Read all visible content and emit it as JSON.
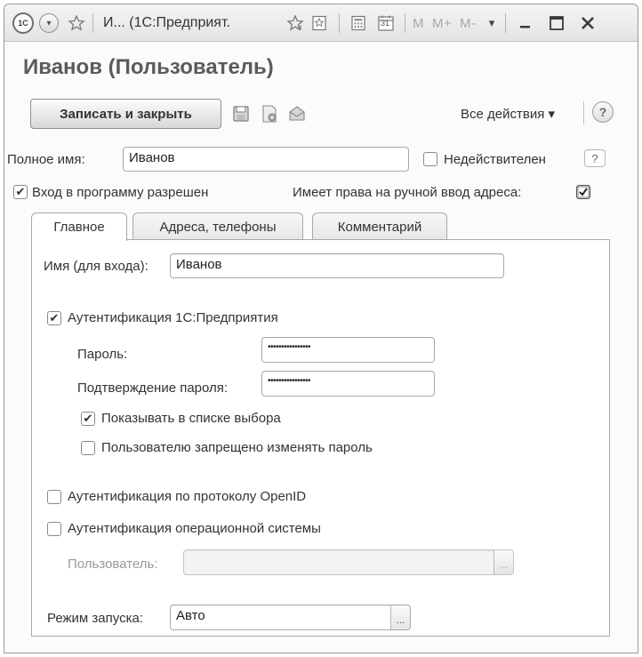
{
  "titlebar": {
    "logo_text": "1С",
    "title": "И... (1С:Предприят.",
    "calendar_day": "31",
    "m_buttons": [
      "M",
      "M+",
      "M-"
    ]
  },
  "form": {
    "title": "Иванов (Пользователь)"
  },
  "toolbar": {
    "save_close_label": "Записать и закрыть",
    "all_actions_label": "Все действия ▾",
    "help_label": "?"
  },
  "full_name": {
    "label": "Полное имя:",
    "value": "Иванов"
  },
  "inactive": {
    "label": "Недействителен",
    "checked": false,
    "help_label": "?"
  },
  "login_allowed": {
    "label": "Вход в программу разрешен",
    "checked": true
  },
  "manual_address": {
    "label": "Имеет права на ручной ввод адреса:",
    "checked": true
  },
  "tabs": [
    {
      "label": "Главное",
      "active": true
    },
    {
      "label": "Адреса, телефоны",
      "active": false
    },
    {
      "label": "Комментарий",
      "active": false
    }
  ],
  "main": {
    "login_name": {
      "label": "Имя (для входа):",
      "value": "Иванов"
    },
    "auth_1c": {
      "label": "Аутентификация 1С:Предприятия",
      "checked": true
    },
    "password": {
      "label": "Пароль:",
      "value": "••••••••••••••••"
    },
    "password_confirm": {
      "label": "Подтверждение пароля:",
      "value": "••••••••••••••••"
    },
    "show_in_list": {
      "label": "Показывать в списке выбора",
      "checked": true
    },
    "forbid_change": {
      "label": "Пользователю запрещено изменять пароль",
      "checked": false
    },
    "auth_openid": {
      "label": "Аутентификация по протоколу OpenID",
      "checked": false
    },
    "auth_os": {
      "label": "Аутентификация операционной системы",
      "checked": false
    },
    "os_user": {
      "label": "Пользователь:",
      "value": "",
      "pick": "..."
    },
    "launch_mode": {
      "label": "Режим запуска:",
      "value": "Авто",
      "pick": "..."
    }
  },
  "check_mark": "✔"
}
